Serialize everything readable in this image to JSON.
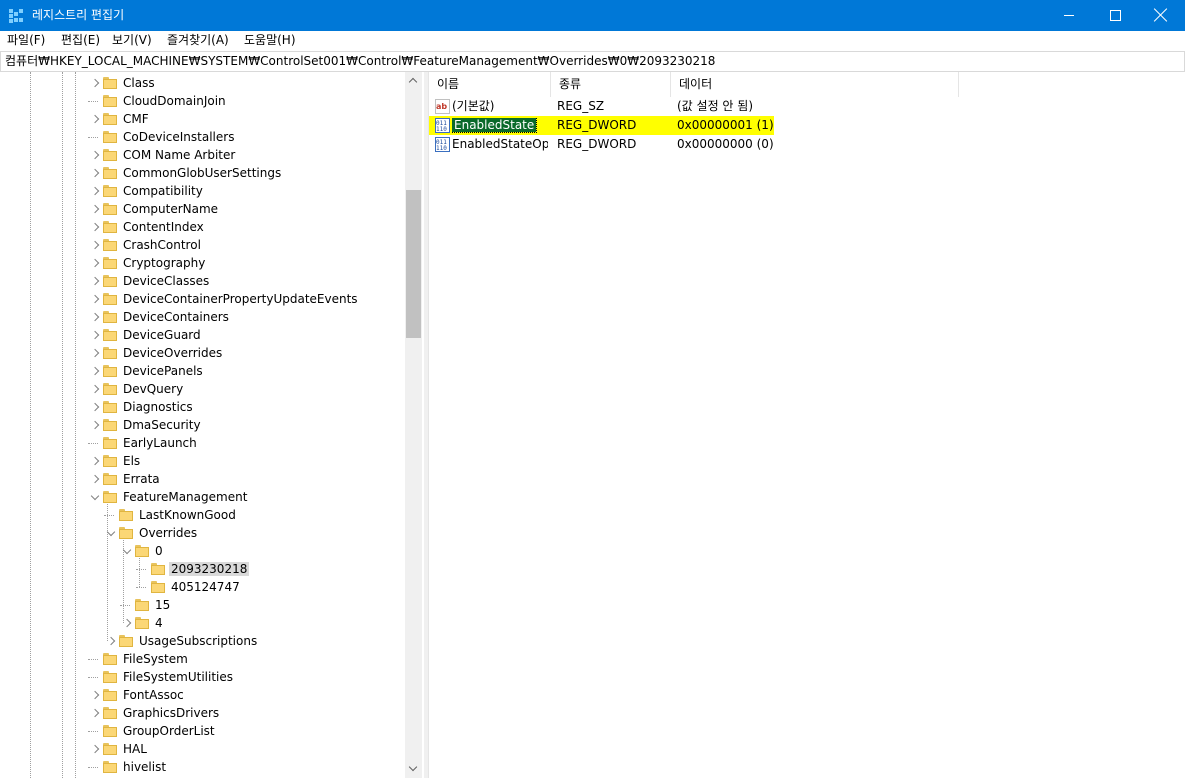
{
  "window": {
    "title": "레지스트리 편집기"
  },
  "menu": [
    "파일(F)",
    "편집(E)",
    "보기(V)",
    "즐겨찾기(A)",
    "도움말(H)"
  ],
  "address": "컴퓨터₩HKEY_LOCAL_MACHINE₩SYSTEM₩ControlSet001₩Control₩FeatureManagement₩Overrides₩0₩2093230218",
  "tree": [
    {
      "label": "Class",
      "expand": "collapsed"
    },
    {
      "label": "CloudDomainJoin",
      "expand": "none"
    },
    {
      "label": "CMF",
      "expand": "collapsed"
    },
    {
      "label": "CoDeviceInstallers",
      "expand": "none"
    },
    {
      "label": "COM Name Arbiter",
      "expand": "collapsed"
    },
    {
      "label": "CommonGlobUserSettings",
      "expand": "collapsed"
    },
    {
      "label": "Compatibility",
      "expand": "collapsed"
    },
    {
      "label": "ComputerName",
      "expand": "collapsed"
    },
    {
      "label": "ContentIndex",
      "expand": "collapsed"
    },
    {
      "label": "CrashControl",
      "expand": "collapsed"
    },
    {
      "label": "Cryptography",
      "expand": "collapsed"
    },
    {
      "label": "DeviceClasses",
      "expand": "collapsed"
    },
    {
      "label": "DeviceContainerPropertyUpdateEvents",
      "expand": "collapsed"
    },
    {
      "label": "DeviceContainers",
      "expand": "collapsed"
    },
    {
      "label": "DeviceGuard",
      "expand": "collapsed"
    },
    {
      "label": "DeviceOverrides",
      "expand": "collapsed"
    },
    {
      "label": "DevicePanels",
      "expand": "collapsed"
    },
    {
      "label": "DevQuery",
      "expand": "collapsed"
    },
    {
      "label": "Diagnostics",
      "expand": "collapsed"
    },
    {
      "label": "DmaSecurity",
      "expand": "collapsed"
    },
    {
      "label": "EarlyLaunch",
      "expand": "none"
    },
    {
      "label": "Els",
      "expand": "collapsed"
    },
    {
      "label": "Errata",
      "expand": "collapsed"
    },
    {
      "label": "FeatureManagement",
      "expand": "expanded"
    },
    {
      "label": "LastKnownGood",
      "expand": "none",
      "level": 1
    },
    {
      "label": "Overrides",
      "expand": "expanded",
      "level": 1
    },
    {
      "label": "0",
      "expand": "expanded",
      "level": 2
    },
    {
      "label": "2093230218",
      "expand": "none",
      "level": 3,
      "selected": true
    },
    {
      "label": "405124747",
      "expand": "none",
      "level": 3
    },
    {
      "label": "15",
      "expand": "none",
      "level": 2
    },
    {
      "label": "4",
      "expand": "collapsed",
      "level": 2
    },
    {
      "label": "UsageSubscriptions",
      "expand": "collapsed",
      "level": 1
    },
    {
      "label": "FileSystem",
      "expand": "none"
    },
    {
      "label": "FileSystemUtilities",
      "expand": "none"
    },
    {
      "label": "FontAssoc",
      "expand": "collapsed"
    },
    {
      "label": "GraphicsDrivers",
      "expand": "collapsed"
    },
    {
      "label": "GroupOrderList",
      "expand": "none"
    },
    {
      "label": "HAL",
      "expand": "collapsed"
    },
    {
      "label": "hivelist",
      "expand": "none"
    }
  ],
  "list": {
    "columns": [
      "이름",
      "종류",
      "데이터"
    ],
    "rows": [
      {
        "name": "(기본값)",
        "type": "REG_SZ",
        "data": "(값 설정 안 됨)",
        "icon": "string-value-icon"
      },
      {
        "name": "EnabledState",
        "type": "REG_DWORD",
        "data": "0x00000001 (1)",
        "icon": "dword-value-icon",
        "highlight": true
      },
      {
        "name": "EnabledStateOp...",
        "type": "REG_DWORD",
        "data": "0x00000000 (0)",
        "icon": "dword-value-icon"
      }
    ]
  },
  "colors": {
    "titlebar": "#0078d7",
    "highlight": "#ffff00",
    "selection": "#d9d9d9"
  }
}
